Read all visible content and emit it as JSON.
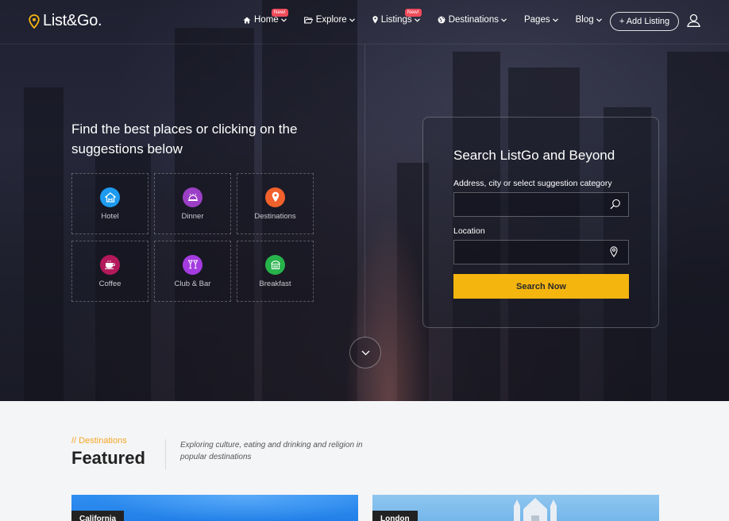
{
  "brand": {
    "name": "List&Go.",
    "accent": "#f5b50f"
  },
  "nav": {
    "items": [
      {
        "label": "Home",
        "icon": "home-icon",
        "badge": "New!"
      },
      {
        "label": "Explore",
        "icon": "folder-open-icon",
        "badge": ""
      },
      {
        "label": "Listings",
        "icon": "map-pin-icon",
        "badge": "New!"
      },
      {
        "label": "Destinations",
        "icon": "globe-icon",
        "badge": ""
      },
      {
        "label": "Pages",
        "icon": "",
        "badge": ""
      },
      {
        "label": "Blog",
        "icon": "",
        "badge": ""
      }
    ],
    "add_listing": "+ Add Listing"
  },
  "hero": {
    "headline": "Find the best places or clicking on the suggestions below",
    "categories": [
      {
        "label": "Hotel",
        "icon": "hotel-icon",
        "color": "#1e9bf0"
      },
      {
        "label": "Dinner",
        "icon": "dinner-icon",
        "color": "#9b3fc6"
      },
      {
        "label": "Destinations",
        "icon": "location-pin-icon",
        "color": "#f2612b"
      },
      {
        "label": "Coffee",
        "icon": "coffee-icon",
        "color": "#b3195b"
      },
      {
        "label": "Club & Bar",
        "icon": "cocktail-icon",
        "color": "#a43be0"
      },
      {
        "label": "Breakfast",
        "icon": "breakfast-icon",
        "color": "#27b24b"
      }
    ]
  },
  "search": {
    "title": "Search ListGo and Beyond",
    "address_label": "Address, city or select suggestion category",
    "address_value": "",
    "location_label": "Location",
    "location_value": "",
    "button": "Search Now"
  },
  "featured": {
    "kicker": "// Destinations",
    "title": "Featured",
    "description": "Exploring culture, eating and drinking and religion in popular destinations",
    "cards": [
      {
        "label": "California"
      },
      {
        "label": "London"
      }
    ]
  }
}
